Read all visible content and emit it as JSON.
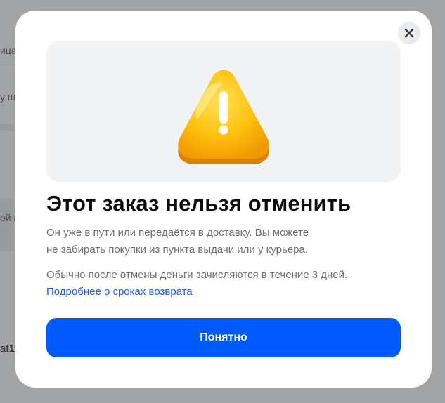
{
  "background": {
    "fragments": [
      "ица",
      "у ш",
      "ой и",
      "at11"
    ]
  },
  "dialog": {
    "close_icon": "close-icon",
    "illustration_icon": "warning-triangle-icon",
    "title": "Этот заказ нельзя отменить",
    "paragraph1_line1": "Он уже в пути или передаётся в доставку. Вы можете",
    "paragraph1_line2": "не забирать покупки из пункта выдачи или у курьера.",
    "paragraph2": "Обычно после отмены деньги зачисляются в течение 3 дней.",
    "link": "Подробнее о сроках возврата",
    "ok_button": "Понятно",
    "colors": {
      "accent": "#005bff",
      "link": "#1a5cf0",
      "warning": "#ffc400"
    }
  }
}
